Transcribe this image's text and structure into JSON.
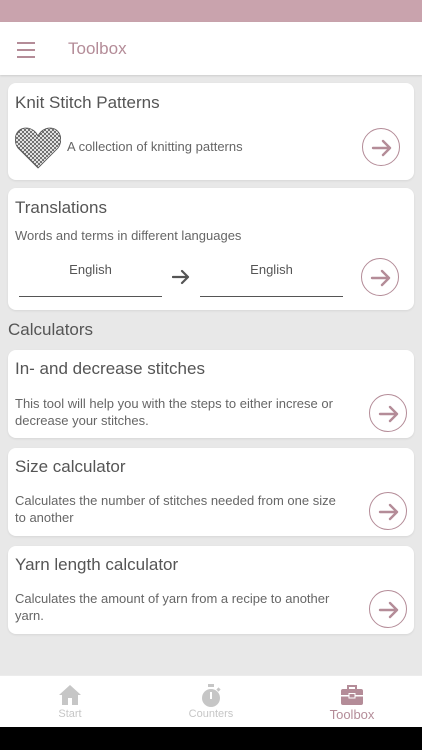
{
  "appbar": {
    "title": "Toolbox"
  },
  "cards": {
    "patterns": {
      "title": "Knit Stitch Patterns",
      "desc": "A collection of knitting patterns"
    },
    "translations": {
      "title": "Translations",
      "desc": "Words and terms in different languages",
      "from_lang": "English",
      "to_lang": "English"
    }
  },
  "section": {
    "calculators": "Calculators"
  },
  "calculators": {
    "incdec": {
      "title": "In- and decrease stitches",
      "desc": "This tool will help you with the steps to either increse or decrease your stitches."
    },
    "size": {
      "title": "Size calculator",
      "desc": "Calculates the number of stitches needed from one size to another"
    },
    "yarn": {
      "title": "Yarn length calculator",
      "desc": "Calculates the amount of yarn from a recipe to another yarn."
    }
  },
  "nav": {
    "start": "Start",
    "counters": "Counters",
    "toolbox": "Toolbox"
  },
  "colors": {
    "accent": "#b48c98",
    "statusbar": "#c9a3ad",
    "background": "#e8e8e8",
    "inactive": "#c6c6c6"
  },
  "icons": {
    "menu": "menu-icon",
    "heart": "cross-stitch-heart-icon",
    "arrow": "arrow-right-icon",
    "start": "home-icon",
    "counters": "stopwatch-icon",
    "toolbox": "toolbox-icon"
  }
}
